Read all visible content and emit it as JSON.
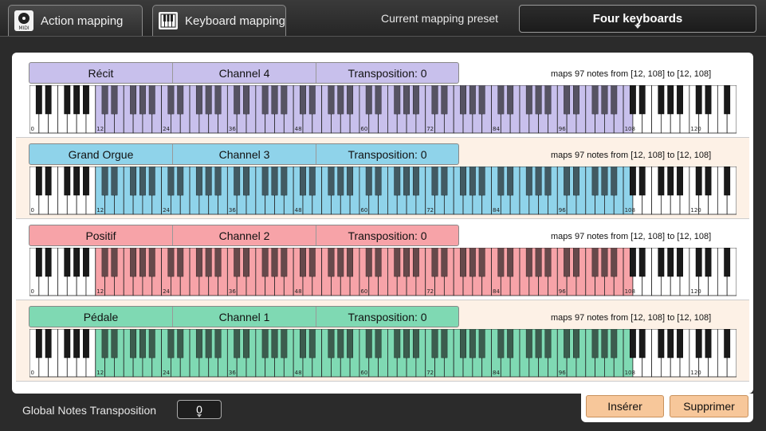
{
  "tabs": [
    {
      "label": "Action mapping",
      "icon": "midi-icon"
    },
    {
      "label": "Keyboard mapping",
      "icon": "piano-icon"
    }
  ],
  "preset": {
    "label": "Current mapping preset",
    "value": "Four keyboards"
  },
  "keyboard_range": {
    "min_note": 0,
    "max_note": 127,
    "tick_labels": [
      "0",
      "12",
      "24",
      "36",
      "48",
      "60",
      "72",
      "84",
      "96",
      "108",
      "120"
    ]
  },
  "mappings": [
    {
      "name": "Récit",
      "channel": "Channel 4",
      "transposition": "Transposition: 0",
      "info": "maps 97 notes from [12, 108] to [12, 108]",
      "range_from": 12,
      "range_to": 108,
      "color": "#c8c0ec"
    },
    {
      "name": "Grand Orgue",
      "channel": "Channel 3",
      "transposition": "Transposition: 0",
      "info": "maps 97 notes from [12, 108] to [12, 108]",
      "range_from": 12,
      "range_to": 108,
      "color": "#8fd3ea"
    },
    {
      "name": "Positif",
      "channel": "Channel 2",
      "transposition": "Transposition: 0",
      "info": "maps 97 notes from [12, 108] to [12, 108]",
      "range_from": 12,
      "range_to": 108,
      "color": "#f7a3a8"
    },
    {
      "name": "Pédale",
      "channel": "Channel 1",
      "transposition": "Transposition: 0",
      "info": "maps 97 notes from [12, 108] to [12, 108]",
      "range_from": 12,
      "range_to": 108,
      "color": "#7fd9b3"
    }
  ],
  "global": {
    "label": "Global Notes Transposition",
    "value": "0"
  },
  "buttons": {
    "insert": "Insérer",
    "delete": "Supprimer"
  }
}
